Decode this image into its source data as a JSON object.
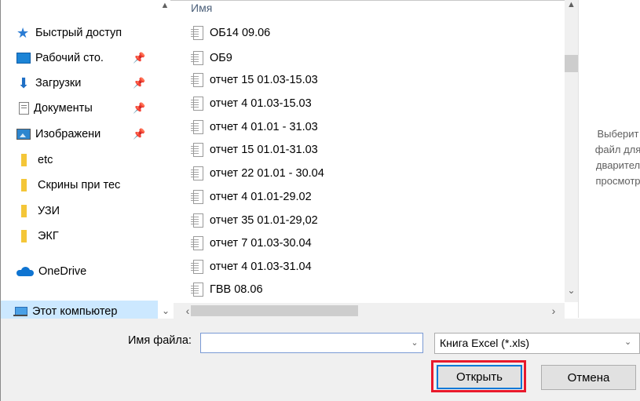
{
  "navigation": {
    "quick_access": "Быстрый доступ",
    "items": [
      {
        "label": "Рабочий сто.",
        "icon": "desktop-icon",
        "pinned": true
      },
      {
        "label": "Загрузки",
        "icon": "download-icon",
        "pinned": true
      },
      {
        "label": "Документы",
        "icon": "documents-icon",
        "pinned": true
      },
      {
        "label": "Изображени",
        "icon": "pictures-icon",
        "pinned": true
      },
      {
        "label": "etc",
        "icon": "folder-icon",
        "pinned": false
      },
      {
        "label": "Скрины при тес",
        "icon": "folder-icon",
        "pinned": false
      },
      {
        "label": "УЗИ",
        "icon": "folder-icon",
        "pinned": false
      },
      {
        "label": "ЭКГ",
        "icon": "folder-icon",
        "pinned": false
      }
    ],
    "onedrive": "OneDrive",
    "this_pc": "Этот компьютер",
    "pin_glyph": "📌"
  },
  "file_list": {
    "column_header": "Имя",
    "files": [
      "ОБ14 09.06",
      "ОБ9",
      "отчет 15 01.03-15.03",
      "отчет 4 01.03-15.03",
      "отчет 4 01.01 - 31.03",
      "отчет 15 01.01-31.03",
      "отчет 22 01.01 - 30.04",
      "отчет 4 01.01-29.02",
      "отчет 35 01.01-29,02",
      "отчет 7 01.03-30.04",
      "отчет 4 01.03-31.04",
      "ГВВ 08.06"
    ]
  },
  "preview": {
    "lines": [
      "Выберит",
      "файл для",
      "дварител",
      "просмотр"
    ]
  },
  "bottom": {
    "filename_label": "Имя файла:",
    "filename_value": "",
    "filetype_value": "Книга Excel (*.xls)",
    "open_label": "Открыть",
    "cancel_label": "Отмена"
  },
  "colors": {
    "accent": "#0078d7",
    "highlight_box": "#e8192c",
    "selected_nav": "#cce8ff"
  }
}
